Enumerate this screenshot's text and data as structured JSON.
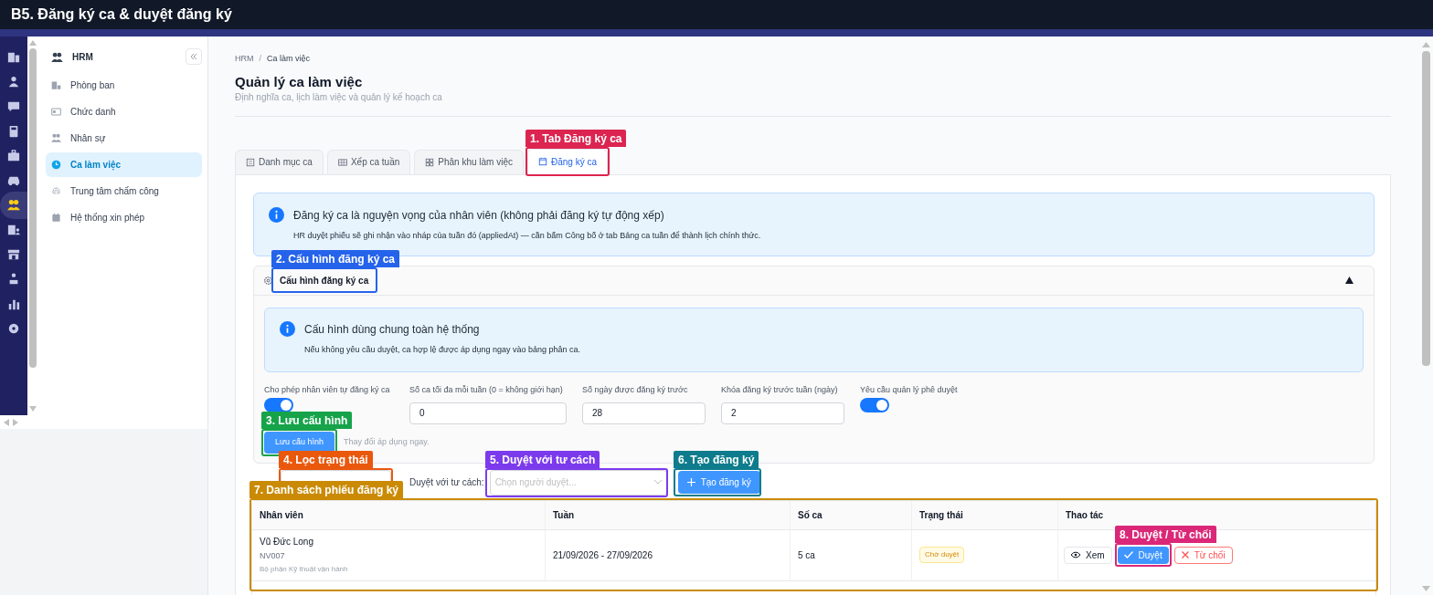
{
  "page_title": "B5. Đăng ký ca & duyệt đăng ký",
  "rail_items": [
    {
      "selected": false
    },
    {
      "selected": false
    },
    {
      "selected": false
    },
    {
      "selected": false
    },
    {
      "selected": false
    },
    {
      "selected": false
    },
    {
      "selected": true
    },
    {
      "selected": false
    },
    {
      "selected": false
    },
    {
      "selected": false
    },
    {
      "selected": false
    },
    {
      "selected": false
    }
  ],
  "sidebar": {
    "title": "HRM",
    "items": [
      {
        "label": "Phòng ban",
        "selected": false
      },
      {
        "label": "Chức danh",
        "selected": false
      },
      {
        "label": "Nhân sự",
        "selected": false
      },
      {
        "label": "Ca làm việc",
        "selected": true
      },
      {
        "label": "Trung tâm chấm công",
        "selected": false
      },
      {
        "label": "Hệ thống xin phép",
        "selected": false
      }
    ]
  },
  "breadcrumb": {
    "items": [
      "HRM",
      "Ca làm việc"
    ],
    "separator": "/"
  },
  "heading": "Quản lý ca làm việc",
  "subtitle": "Định nghĩa ca, lịch làm việc và quản lý kế hoạch ca",
  "tabs": [
    {
      "label": "Danh mục ca",
      "selected": false
    },
    {
      "label": "Xếp ca tuần",
      "selected": false
    },
    {
      "label": "Phân khu làm việc",
      "selected": false
    },
    {
      "label": "Đăng ký ca",
      "selected": true
    }
  ],
  "notice": {
    "title": "Đăng ký ca là nguyện vọng của nhân viên (không phải đăng ký tự động xếp)",
    "text": "HR duyệt phiếu sẽ ghi nhận vào nháp của tuần đó (appliedAt) — cần bấm Công bố ở tab Bảng ca tuần để thành lịch chính thức."
  },
  "config": {
    "title": "Cấu hình đăng ký ca",
    "expanded": true,
    "notice": {
      "title": "Cấu hình dùng chung toàn hệ thống",
      "text": "Nếu không yêu cầu duyệt, ca hợp lệ được áp dụng ngay vào bảng phân ca."
    },
    "fields": [
      {
        "kind": "toggle",
        "label": "Cho phép nhân viên tự đăng ký ca",
        "on": true
      },
      {
        "kind": "input",
        "label": "Số ca tối đa mỗi tuần (0 = không giới hạn)",
        "value": "0"
      },
      {
        "kind": "input",
        "label": "Số ngày được đăng ký trước",
        "value": "28"
      },
      {
        "kind": "input",
        "label": "Khóa đăng ký trước tuần (ngày)",
        "value": "2"
      },
      {
        "kind": "toggle",
        "label": "Yêu cầu quản lý phê duyệt",
        "on": true
      }
    ],
    "save_button": "Lưu cấu hình",
    "save_hint": "Thay đổi áp dụng ngay."
  },
  "filters": {
    "approver_label": "Duyệt với tư cách:",
    "approver_placeholder": "Chọn người duyệt...",
    "create_button": "Tạo đăng ký"
  },
  "table": {
    "columns": [
      "Nhân viên",
      "Tuần",
      "Số ca",
      "Trạng thái",
      "Thao tác"
    ],
    "rows": [
      {
        "name": "Vũ Đức Long",
        "code": "NV007",
        "department": "Bộ phận Kỹ thuật vận hành",
        "week": "21/09/2026 - 27/09/2026",
        "shifts": "5 ca",
        "status": {
          "label": "Chờ duyệt",
          "kind": "pending"
        },
        "actions": [
          {
            "kind": "view",
            "label": "Xem"
          },
          {
            "kind": "approve",
            "label": "Duyệt"
          },
          {
            "kind": "reject",
            "label": "Từ chối"
          }
        ]
      }
    ]
  },
  "annotations": [
    {
      "label": "1. Tab Đăng ký ca",
      "color": "#dc2450"
    },
    {
      "label": "2. Cấu hình đăng ký ca",
      "color": "#2563eb"
    },
    {
      "label": "3. Lưu cấu hình",
      "color": "#16a34a"
    },
    {
      "label": "4. Lọc trạng thái",
      "color": "#ea580c"
    },
    {
      "label": "5. Duyệt với tư cách",
      "color": "#7c3aed"
    },
    {
      "label": "6. Tạo đăng ký",
      "color": "#0e7c8c"
    },
    {
      "label": "7. Danh sách phiếu đăng ký",
      "color": "#ca8a04"
    },
    {
      "label": "8. Duyệt / Từ chối",
      "color": "#db2777"
    }
  ]
}
